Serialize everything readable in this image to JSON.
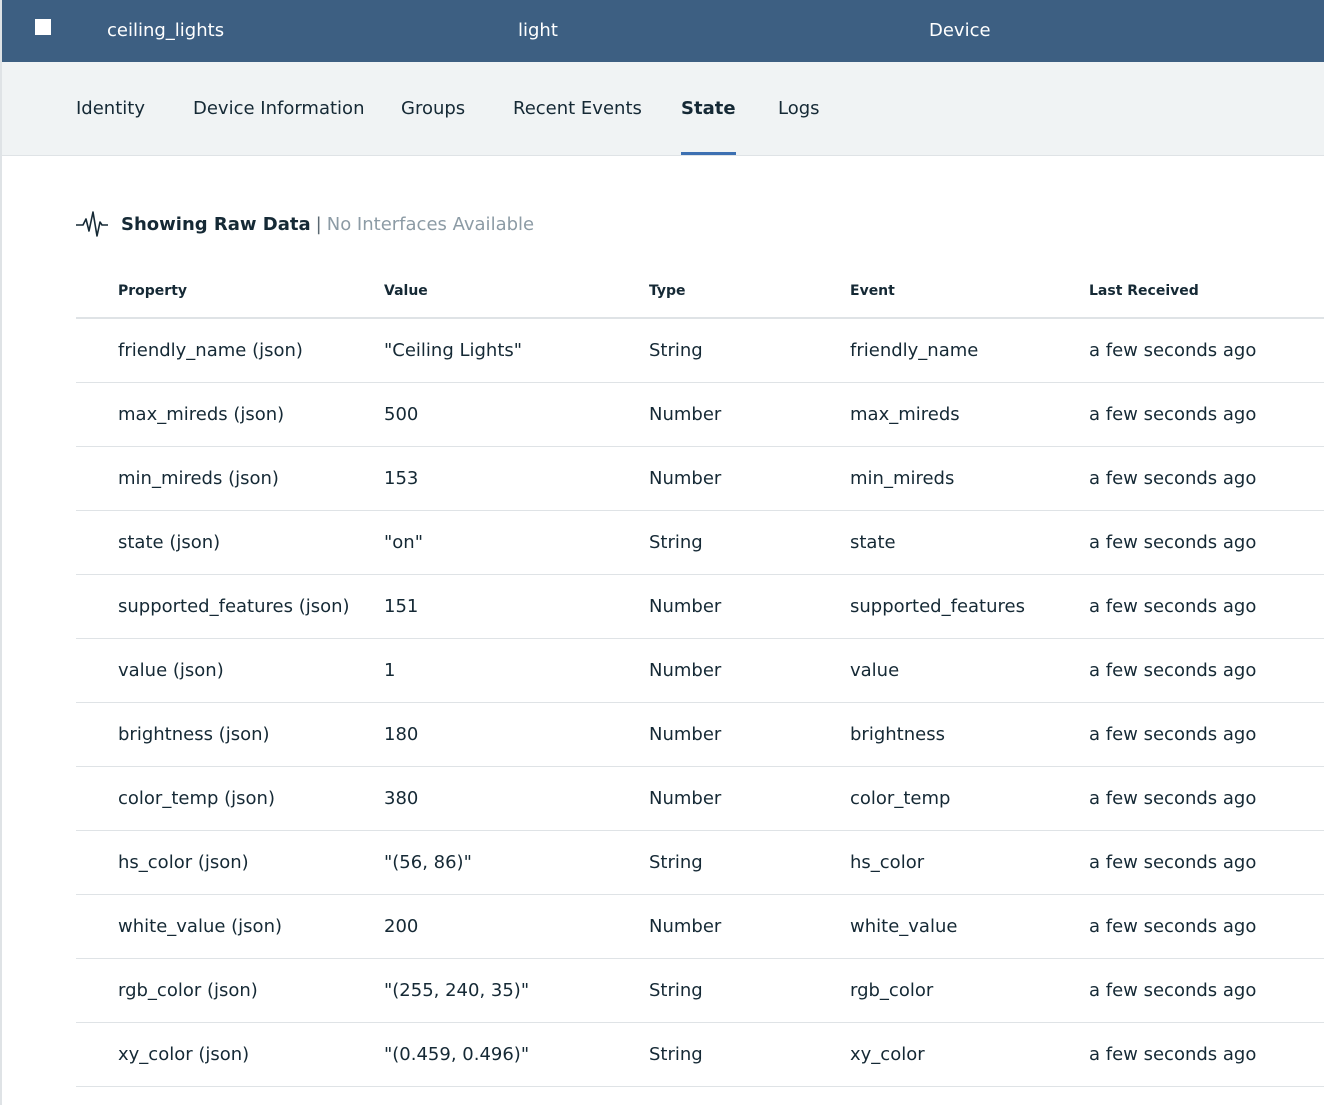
{
  "header": {
    "name": "ceiling_lights",
    "type": "light",
    "kind": "Device"
  },
  "tabs": {
    "identity": "Identity",
    "device_information": "Device Information",
    "groups": "Groups",
    "recent_events": "Recent Events",
    "state": "State",
    "logs": "Logs",
    "active": "State"
  },
  "raw_data": {
    "icon": "activity-pulse-icon",
    "title": "Showing Raw Data",
    "separator": "|",
    "subtitle": "No Interfaces Available"
  },
  "table": {
    "columns": {
      "property": "Property",
      "value": "Value",
      "type": "Type",
      "event": "Event",
      "last_received": "Last Received"
    },
    "rows": [
      {
        "property": "friendly_name (json)",
        "value": "\"Ceiling Lights\"",
        "type": "String",
        "event": "friendly_name",
        "last_received": "a few seconds ago"
      },
      {
        "property": "max_mireds (json)",
        "value": "500",
        "type": "Number",
        "event": "max_mireds",
        "last_received": "a few seconds ago"
      },
      {
        "property": "min_mireds (json)",
        "value": "153",
        "type": "Number",
        "event": "min_mireds",
        "last_received": "a few seconds ago"
      },
      {
        "property": "state (json)",
        "value": "\"on\"",
        "type": "String",
        "event": "state",
        "last_received": "a few seconds ago"
      },
      {
        "property": "supported_features (json)",
        "value": "151",
        "type": "Number",
        "event": "supported_features",
        "last_received": "a few seconds ago"
      },
      {
        "property": "value (json)",
        "value": "1",
        "type": "Number",
        "event": "value",
        "last_received": "a few seconds ago"
      },
      {
        "property": "brightness (json)",
        "value": "180",
        "type": "Number",
        "event": "brightness",
        "last_received": "a few seconds ago"
      },
      {
        "property": "color_temp (json)",
        "value": "380",
        "type": "Number",
        "event": "color_temp",
        "last_received": "a few seconds ago"
      },
      {
        "property": "hs_color (json)",
        "value": "\"(56, 86)\"",
        "type": "String",
        "event": "hs_color",
        "last_received": "a few seconds ago"
      },
      {
        "property": "white_value (json)",
        "value": "200",
        "type": "Number",
        "event": "white_value",
        "last_received": "a few seconds ago"
      },
      {
        "property": "rgb_color (json)",
        "value": "\"(255, 240, 35)\"",
        "type": "String",
        "event": "rgb_color",
        "last_received": "a few seconds ago"
      },
      {
        "property": "xy_color (json)",
        "value": "\"(0.459, 0.496)\"",
        "type": "String",
        "event": "xy_color",
        "last_received": "a few seconds ago"
      }
    ]
  },
  "colors": {
    "header_bar": "#3d5f82",
    "tab_bar": "#f0f3f4",
    "active_tab_indicator": "#3d70b2",
    "text": "#152935",
    "muted_text": "#8c9ba5",
    "divider": "#dfe3e6"
  }
}
